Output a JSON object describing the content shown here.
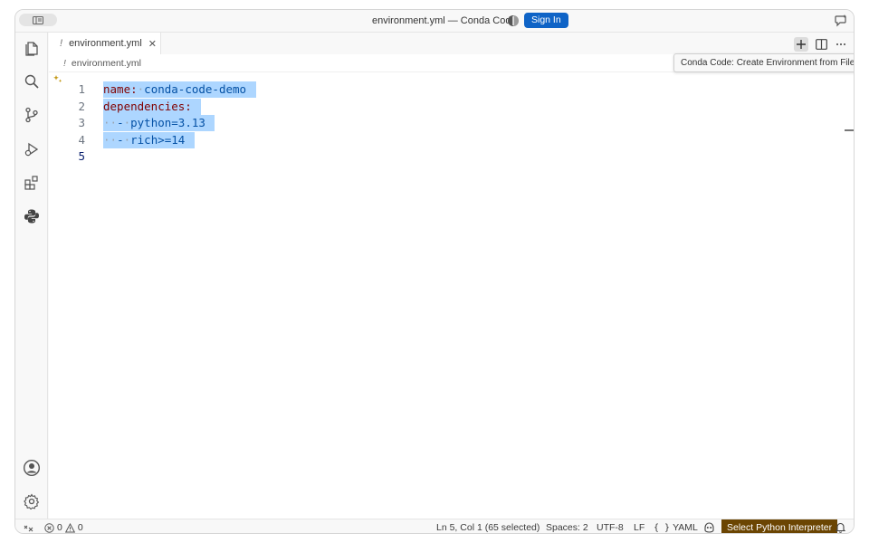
{
  "window": {
    "title": "environment.yml — Conda Code",
    "signin_label": "Sign In"
  },
  "tab": {
    "marker": "!",
    "filename": "environment.yml",
    "close": "✕"
  },
  "breadcrumb": {
    "marker": "!",
    "filename": "environment.yml"
  },
  "tooltip": {
    "text": "Conda Code: Create Environment from File"
  },
  "editor": {
    "lines": [
      {
        "number": "1",
        "key": "name:",
        "sep": "·",
        "value": "conda-code-demo"
      },
      {
        "number": "2",
        "key": "dependencies:"
      },
      {
        "number": "3",
        "indent": "··",
        "dash": "-",
        "sep": "·",
        "value": "python=3.13"
      },
      {
        "number": "4",
        "indent": "··",
        "dash": "-",
        "sep": "·",
        "value": "rich>=14"
      },
      {
        "number": "5"
      }
    ]
  },
  "statusbar": {
    "errors": "0",
    "warnings": "0",
    "position": "Ln 5, Col 1 (65 selected)",
    "spaces": "Spaces: 2",
    "encoding": "UTF-8",
    "eol": "LF",
    "language": "YAML",
    "interpreter": "Select Python Interpreter"
  },
  "colors": {
    "accent": "#0e63c6",
    "selection": "#add6ff",
    "yaml_key": "#800000",
    "yaml_value": "#0451a5",
    "interpreter_bg": "#6b4502"
  }
}
